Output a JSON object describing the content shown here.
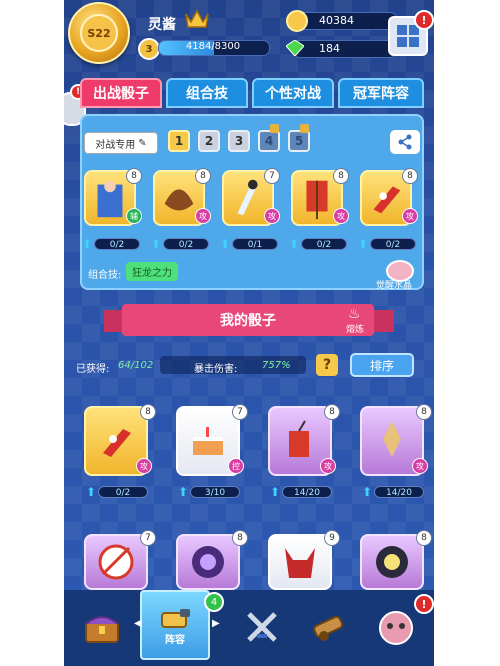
{
  "header": {
    "player_name": "灵酱",
    "rank_label": "S22",
    "level": "3",
    "exp_text": "4184/8300",
    "exp_progress": 0.504,
    "gold": "40384",
    "gems": "184",
    "menu_alert": "!",
    "side_avatar_alert": "!"
  },
  "tabs": [
    {
      "label": "出战骰子",
      "active": true
    },
    {
      "label": "组合技",
      "active": false
    },
    {
      "label": "个性对战",
      "active": false
    },
    {
      "label": "冠军阵容",
      "active": false
    }
  ],
  "deck": {
    "type_label": "对战专用",
    "slots": [
      "1",
      "2",
      "3",
      "4",
      "5"
    ],
    "active_slot": "1",
    "dice": [
      {
        "name": "knight-dice",
        "level": "8",
        "role": "辅",
        "role_color": "#28b45a",
        "progress": "0/2",
        "style": "yellow"
      },
      {
        "name": "lion-dice",
        "level": "8",
        "role": "攻",
        "role_color": "#d93ea4",
        "progress": "0/2",
        "style": "yellow"
      },
      {
        "name": "swordsman-dice",
        "level": "7",
        "role": "攻",
        "role_color": "#d93ea4",
        "progress": "0/1",
        "style": "yellow"
      },
      {
        "name": "banner-dice",
        "level": "8",
        "role": "攻",
        "role_color": "#d93ea4",
        "progress": "0/2",
        "style": "yellow"
      },
      {
        "name": "sword-dice",
        "level": "8",
        "role": "攻",
        "role_color": "#d93ea4",
        "progress": "0/2",
        "style": "yellow"
      }
    ],
    "combo_label": "组合技:",
    "combo_value": "狂龙之力",
    "awaken_label": "觉醒水晶"
  },
  "my_dice": {
    "title": "我的骰子",
    "smelt_label": "熔炼",
    "obtained_label": "已获得:",
    "obtained_value": "64/102",
    "crit_label": "暴击伤害:",
    "crit_value": "757%",
    "help_label": "?",
    "sort_label": "排序",
    "cards_row1": [
      {
        "name": "sword-dice",
        "level": "8",
        "role": "攻",
        "role_color": "#d93ea4",
        "progress": "0/2",
        "style": "yellow"
      },
      {
        "name": "cake-dice",
        "level": "7",
        "role": "控",
        "role_color": "#d93ea4",
        "progress": "3/10",
        "style": "white"
      },
      {
        "name": "firecracker-dice",
        "level": "8",
        "role": "攻",
        "role_color": "#d93ea4",
        "progress": "14/20",
        "style": "purple"
      },
      {
        "name": "crystal-dice",
        "level": "8",
        "role": "攻",
        "role_color": "#d93ea4",
        "progress": "14/20",
        "style": "purple"
      }
    ],
    "cards_row2": [
      {
        "name": "arrow-dice",
        "level": "7",
        "style": "purple"
      },
      {
        "name": "rune-dice",
        "level": "8",
        "style": "purple"
      },
      {
        "name": "demon-dice",
        "level": "9",
        "style": "white"
      },
      {
        "name": "sun-dice",
        "level": "8",
        "style": "purple"
      }
    ]
  },
  "nav": {
    "items": [
      "chest",
      "lineup",
      "battle",
      "cannon",
      "profile"
    ],
    "active_label": "阵容",
    "lineup_badge": "4",
    "profile_alert": "!"
  },
  "colors": {
    "accent_pink": "#ef3b6a",
    "panel_blue": "#4fa8ea",
    "progress_cyan": "#3ed4ff"
  }
}
